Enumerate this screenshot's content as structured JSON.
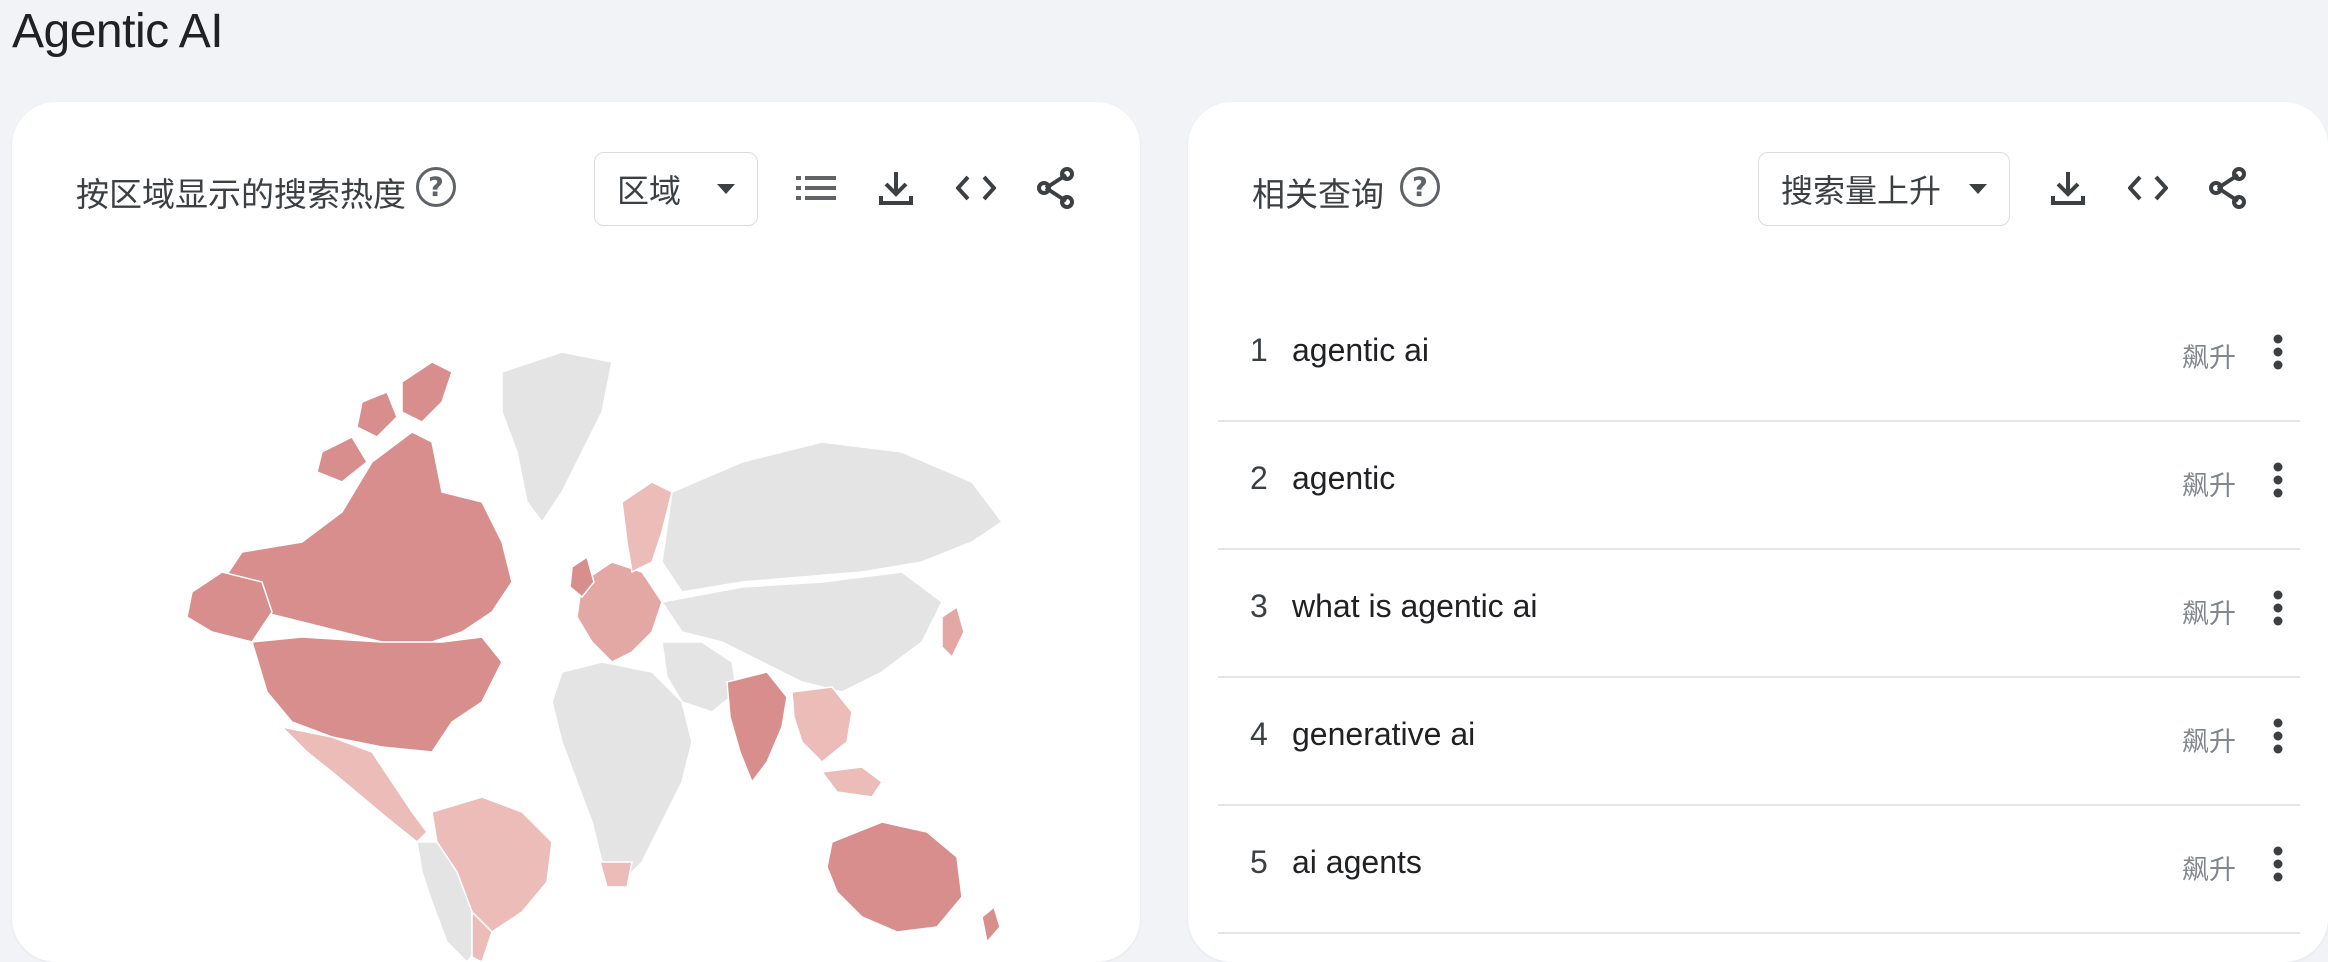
{
  "page": {
    "title": "Agentic AI"
  },
  "region_card": {
    "title": "按区域显示的搜索热度",
    "help_icon": "help-circle-icon",
    "dropdown_value": "区域",
    "tools": [
      "list-icon",
      "download-icon",
      "embed-code-icon",
      "share-icon"
    ],
    "colors": {
      "high": "#d88e8c",
      "mid": "#e3a7a4",
      "low": "#ecbcb9",
      "none": "#e4e4e4"
    }
  },
  "queries_card": {
    "title": "相关查询",
    "help_icon": "help-circle-icon",
    "dropdown_value": "搜索量上升",
    "tools": [
      "download-icon",
      "embed-code-icon",
      "share-icon"
    ],
    "items": [
      {
        "rank": "1",
        "query": "agentic ai",
        "status": "飙升"
      },
      {
        "rank": "2",
        "query": "agentic",
        "status": "飙升"
      },
      {
        "rank": "3",
        "query": "what is agentic ai",
        "status": "飙升"
      },
      {
        "rank": "4",
        "query": "generative ai",
        "status": "飙升"
      },
      {
        "rank": "5",
        "query": "ai agents",
        "status": "飙升"
      }
    ]
  }
}
